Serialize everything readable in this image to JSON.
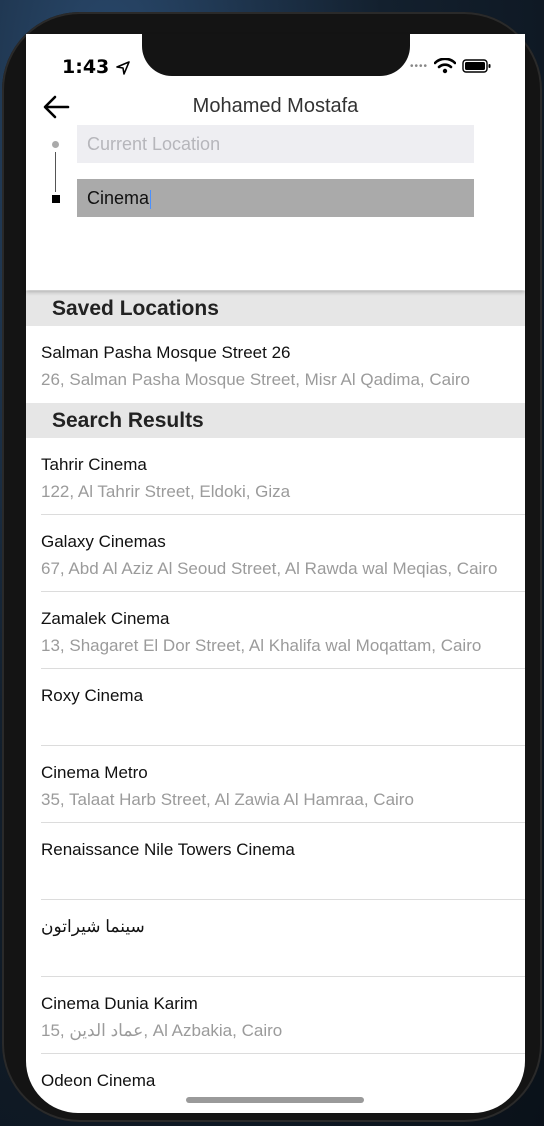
{
  "status": {
    "time": "1:43"
  },
  "header": {
    "title": "Mohamed Mostafa",
    "origin_placeholder": "Current Location",
    "destination_value": "Cinema"
  },
  "sections": {
    "saved_title": "Saved Locations",
    "results_title": "Search Results"
  },
  "saved": [
    {
      "name": "Salman Pasha Mosque Street 26",
      "address": "26, Salman Pasha Mosque Street, Misr Al Qadima, Cairo"
    }
  ],
  "results": [
    {
      "name": "Tahrir Cinema",
      "address": "122, Al Tahrir Street, Eldoki, Giza"
    },
    {
      "name": "Galaxy Cinemas",
      "address": "67, Abd Al Aziz Al Seoud Street, Al Rawda wal Meqias, Cairo"
    },
    {
      "name": "Zamalek Cinema",
      "address": "13, Shagaret El Dor Street, Al Khalifa wal Moqattam, Cairo"
    },
    {
      "name": "Roxy Cinema",
      "address": ""
    },
    {
      "name": "Cinema Metro",
      "address": "35, Talaat Harb Street, Al Zawia Al Hamraa, Cairo"
    },
    {
      "name": "Renaissance Nile Towers Cinema",
      "address": ""
    },
    {
      "name": "سينما شيراتون",
      "address": ""
    },
    {
      "name": "Cinema Dunia Karim",
      "address": "15, عماد الدين, Al Azbakia, Cairo"
    },
    {
      "name": "Odeon Cinema",
      "address": ""
    }
  ]
}
